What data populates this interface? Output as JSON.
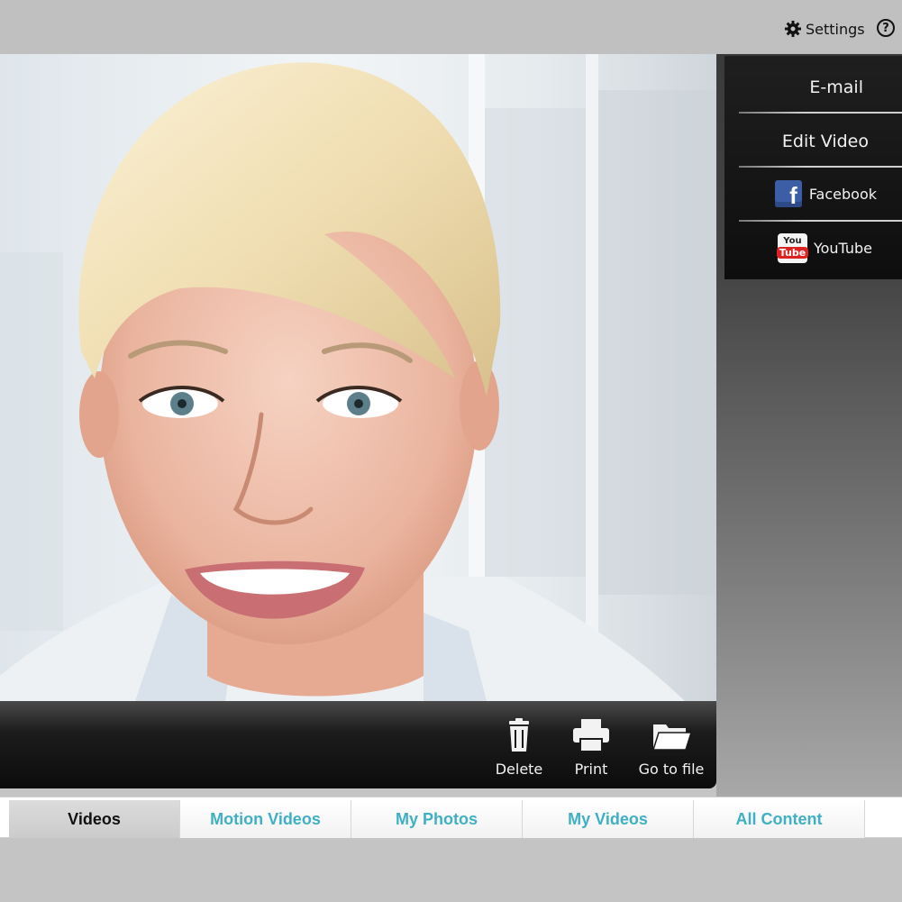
{
  "header": {
    "settings_label": "Settings",
    "settings_icon": "gear-icon",
    "help_label": "?",
    "help_icon": "help-circle-icon"
  },
  "share_menu": {
    "items": [
      {
        "label": "E-mail"
      },
      {
        "label": "Edit Video"
      },
      {
        "label": "Facebook",
        "icon": "facebook-icon",
        "icon_glyph": "f"
      },
      {
        "label": "YouTube",
        "icon": "youtube-icon",
        "icon_you": "You",
        "icon_tube": "Tube"
      }
    ]
  },
  "actions": [
    {
      "label": "Delete",
      "icon": "trash-icon"
    },
    {
      "label": "Print",
      "icon": "printer-icon"
    },
    {
      "label": "Go to file",
      "icon": "folder-icon"
    }
  ],
  "tabs": [
    {
      "label": "Videos",
      "active": true
    },
    {
      "label": "Motion Videos",
      "active": false
    },
    {
      "label": "My Photos",
      "active": false
    },
    {
      "label": "My Videos",
      "active": false
    },
    {
      "label": "All Content",
      "active": false
    }
  ],
  "colors": {
    "tab_text": "#3fb0c4",
    "active_tab_text": "#111111",
    "facebook_blue": "#3b5ea6",
    "youtube_red": "#dd2222"
  }
}
